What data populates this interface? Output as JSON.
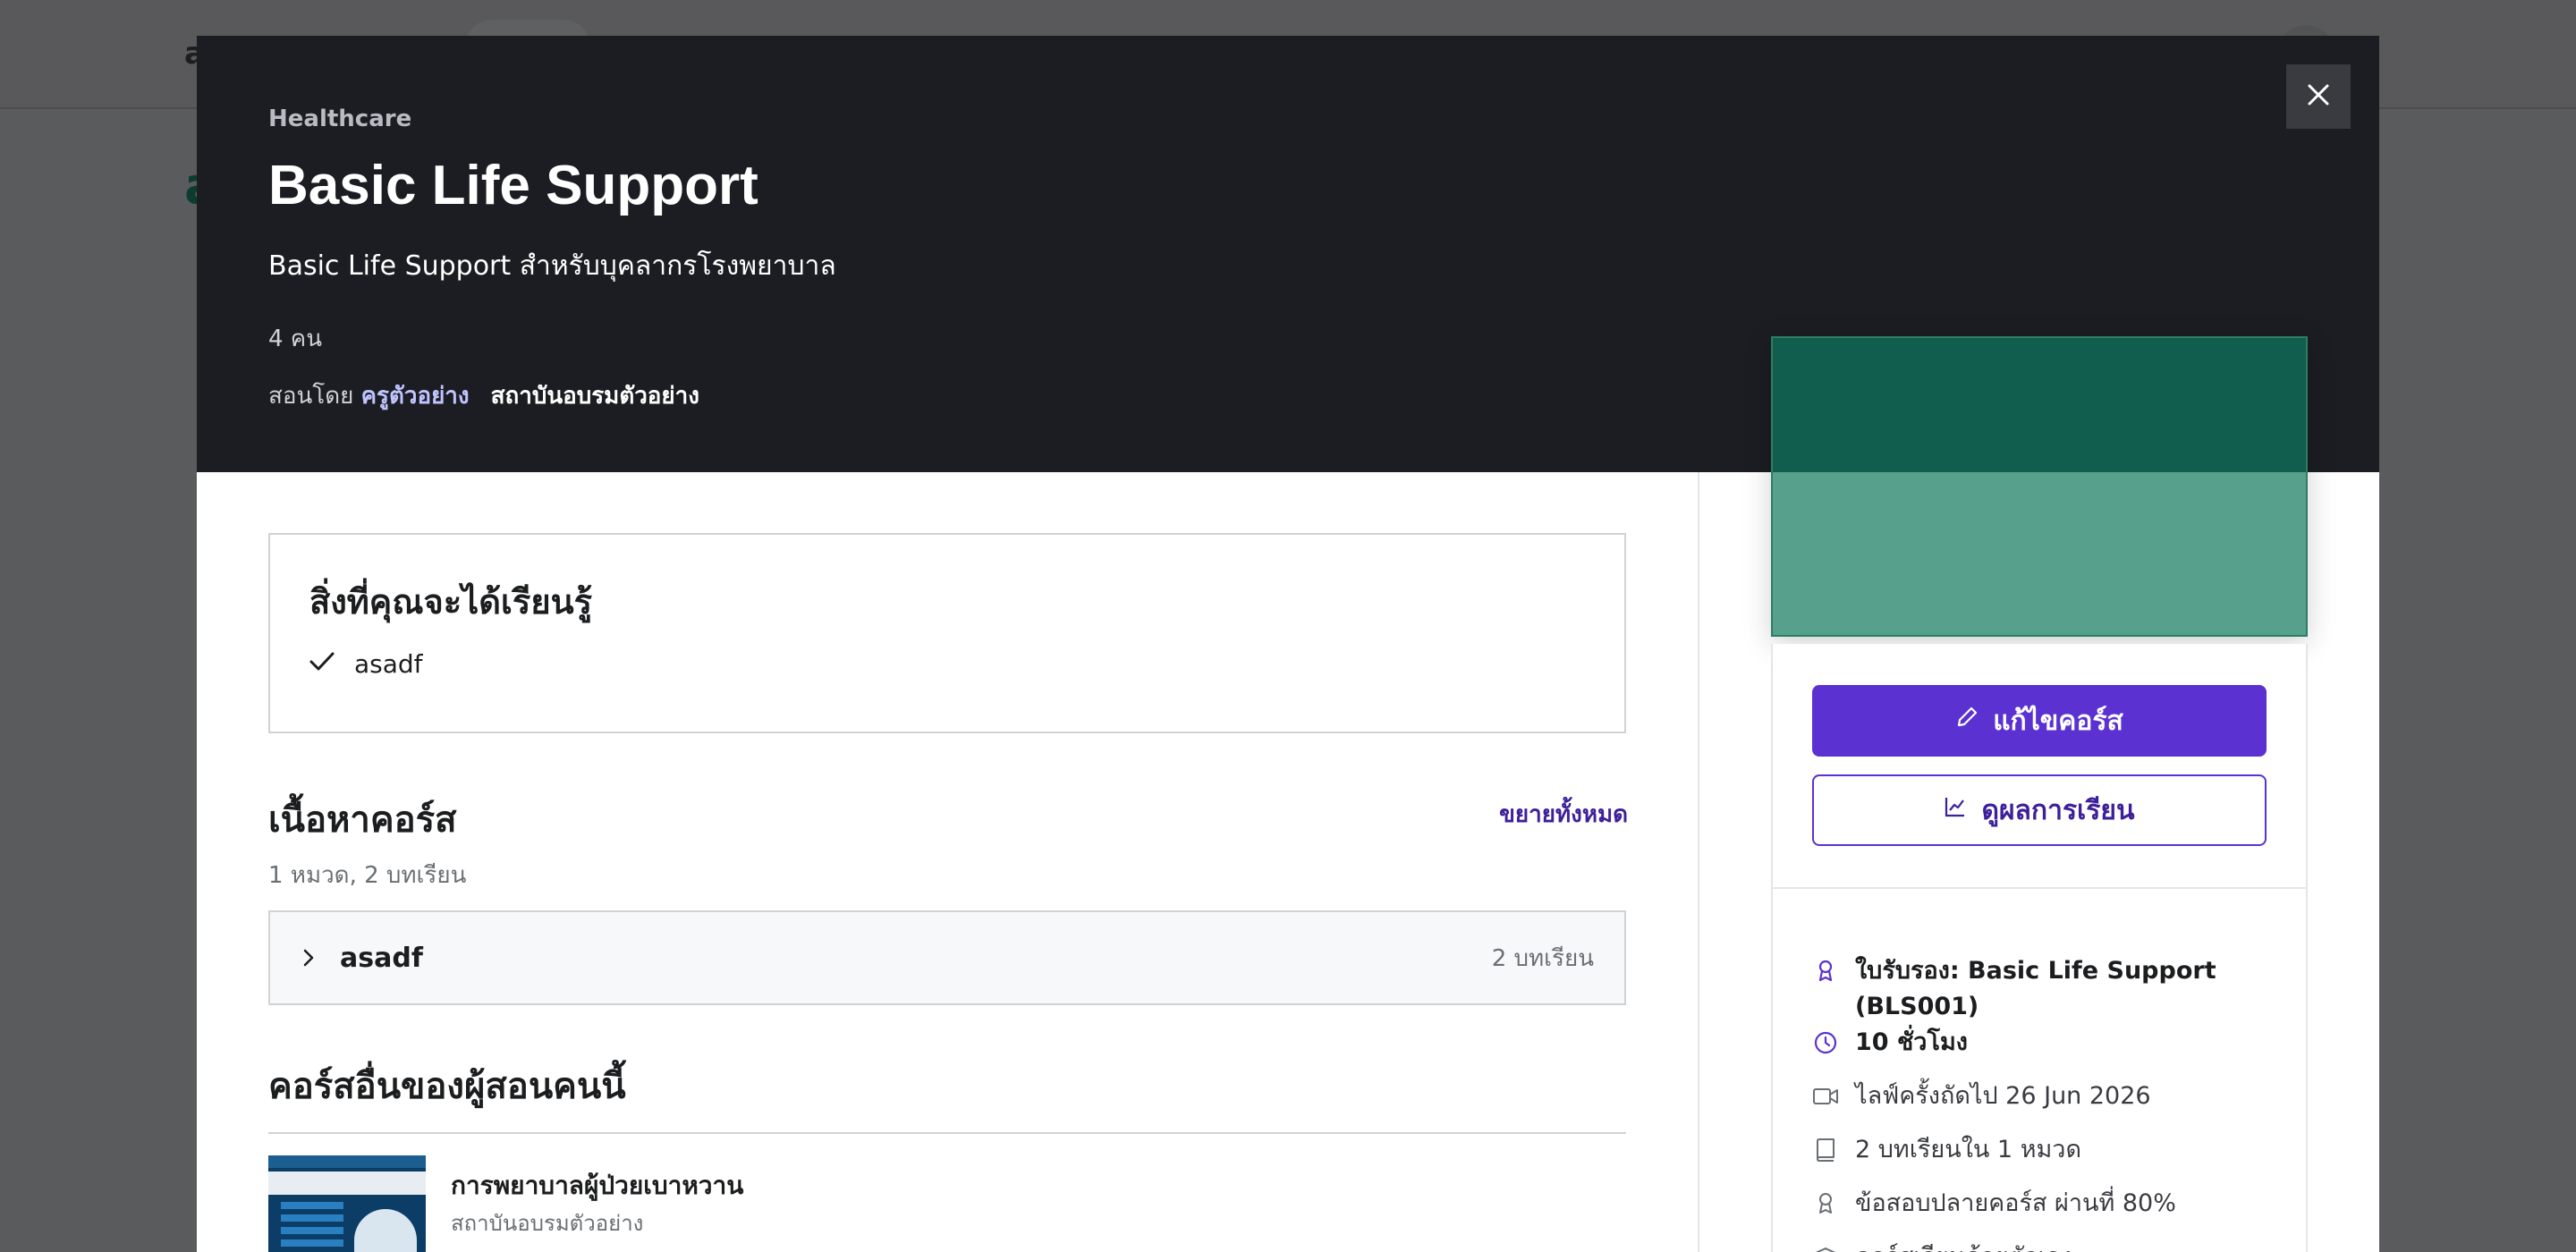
{
  "background": {
    "logo": "a",
    "title": "a",
    "sub": ""
  },
  "modal": {
    "category": "Healthcare",
    "title": "Basic Life Support",
    "subtitle": "Basic Life Support สำหรับบุคลากรโรงพยาบาล",
    "students": "4 คน",
    "taught_by_label": "สอนโดย",
    "instructor": "ครูตัวอย่าง",
    "institution": "สถาบันอบรมตัวอย่าง",
    "close_icon": "close-icon"
  },
  "learn": {
    "title": "สิ่งที่คุณจะได้เรียนรู้",
    "items": [
      "asadf"
    ]
  },
  "content": {
    "title": "เนื้อหาคอร์ส",
    "expand_all": "ขยายทั้งหมด",
    "meta": "1 หมวด, 2 บทเรียน",
    "sections": [
      {
        "name": "asadf",
        "count": "2 บทเรียน"
      }
    ]
  },
  "other": {
    "title": "คอร์สอื่นของผู้สอนคนนี้",
    "courses": [
      {
        "name": "การพยาบาลผู้ป่วยเบาหวาน",
        "institution": "สถาบันอบรมตัวอย่าง"
      }
    ]
  },
  "sidebar": {
    "edit_button": "แก้ไขคอร์ส",
    "results_button": "ดูผลการเรียน",
    "features": [
      {
        "icon": "award-icon",
        "text": "ใบรับรอง: Basic Life Support (BLS001)"
      },
      {
        "icon": "clock-icon",
        "text": "10 ชั่วโมง"
      },
      {
        "icon": "video-icon",
        "text": "ไลฟ์ครั้งถัดไป 26 Jun 2026"
      },
      {
        "icon": "book-icon",
        "text": "2 บทเรียนใน 1 หมวด"
      },
      {
        "icon": "award-icon",
        "text": "ข้อสอบปลายคอร์ส ผ่านที่ 80%"
      },
      {
        "icon": "graduation-cap-icon",
        "text": "คอร์สเรียนด้วยตัวเอง"
      }
    ]
  },
  "colors": {
    "primary": "#5b31d1",
    "header_bg": "#1c1d22",
    "thumb_dark": "#115e4e",
    "thumb_light": "#57a18c"
  }
}
